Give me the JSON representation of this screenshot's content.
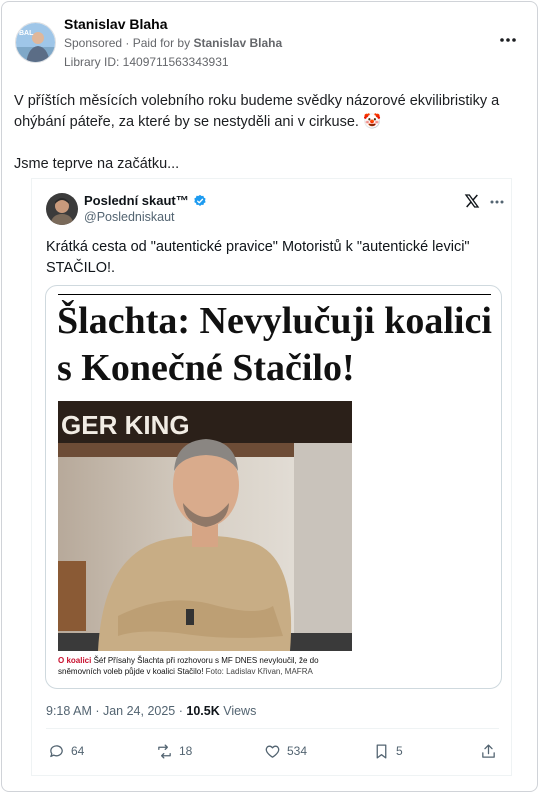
{
  "ad": {
    "page_name": "Stanislav Blaha",
    "sponsored_label": "Sponsored",
    "paid_for_prefix": "Paid for by",
    "paid_for_name": "Stanislav Blaha",
    "library_id": "Library ID: 1409711563343931",
    "avatar_text": "BAL",
    "text_line1": "V příštích měsících volebního roku budeme svědky názorové ekvilibristiky a ohýbání páteře, za které by se nestyděli ani v cirkuse. 🤡",
    "text_line2": "Jsme teprve na začátku..."
  },
  "tweet": {
    "author_name": "Poslední skaut™",
    "handle": "@Posledniskaut",
    "text": "Krátká cesta od \"autentické pravice\" Motoristů k \"autentické levici\" STAČILO!.",
    "article": {
      "headline_line1": "Šlachta: Nevylučuji koalici",
      "headline_line2": "s Konečné Stačilo!",
      "photo_sign": "GER KING",
      "caption_lead": "O koalici",
      "caption_body": "Šéf Přísahy Šlachta při rozhovoru s MF DNES nevyloučil, že do sněmovních voleb půjde v koalici Stačilo!",
      "caption_credit": "Foto: Ladislav Křivan, MAFRA"
    },
    "time": "9:18 AM · Jan 24, 2025 · ",
    "views_count": "10.5K",
    "views_label": " Views",
    "replies": "64",
    "reposts": "18",
    "likes": "534",
    "bookmarks": "5"
  },
  "colors": {
    "verified": "#1d9bf0",
    "caption_accent": "#c8102e",
    "muted": "#65676b"
  }
}
